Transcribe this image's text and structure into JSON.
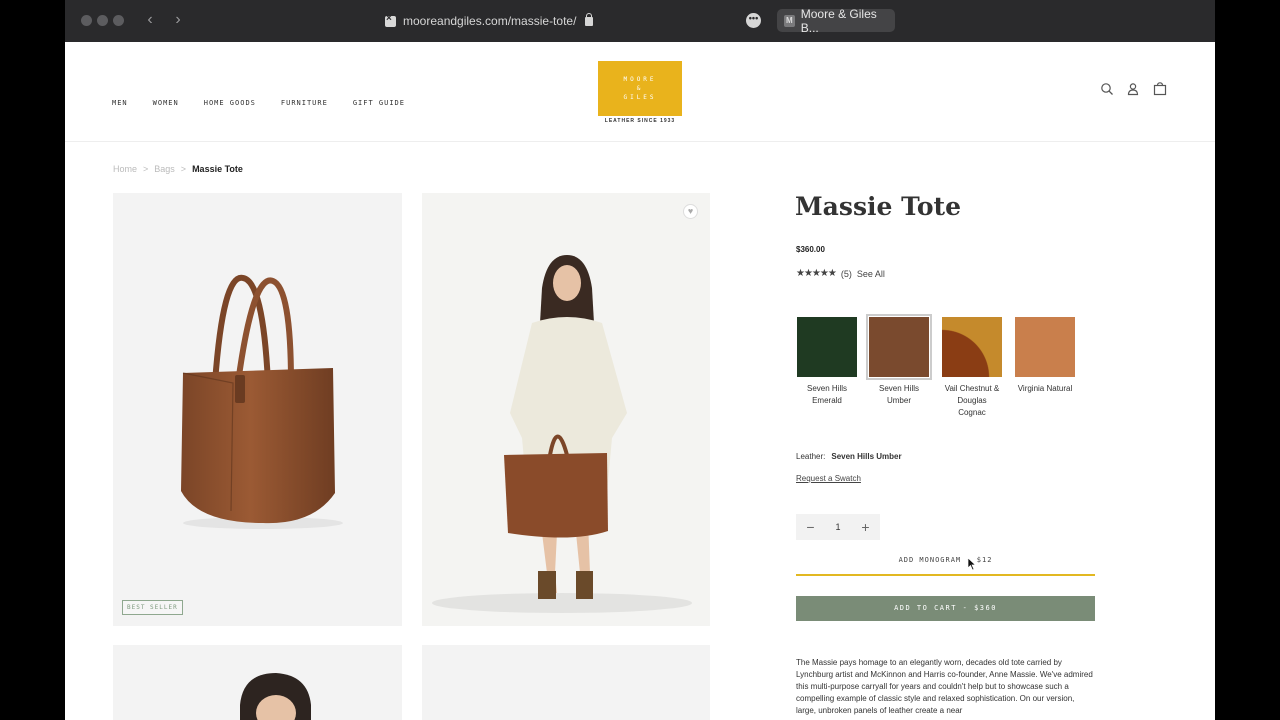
{
  "browser": {
    "url": "mooreandgiles.com/massie-tote/",
    "tab_title": "Moore & Giles B...",
    "tab_favicon_letter": "M",
    "icons": [
      "back-icon",
      "forward-icon",
      "lock-icon",
      "more-icon"
    ]
  },
  "header": {
    "nav": [
      "MEN",
      "WOMEN",
      "HOME GOODS",
      "FURNITURE",
      "GIFT GUIDE"
    ],
    "logo_lines": [
      "MOORE",
      "&",
      "GILES"
    ],
    "logo_tagline": "LEATHER SINCE 1933",
    "logo_color": "#e9b31c",
    "icons": [
      "search-icon",
      "account-icon",
      "cart-icon"
    ]
  },
  "breadcrumb": {
    "items": [
      "Home",
      "Bags",
      "Massie Tote"
    ],
    "separator": ">"
  },
  "gallery": {
    "badge": "BEST SELLER",
    "icons": [
      "wishlist-heart-icon"
    ]
  },
  "product": {
    "title": "Massie Tote",
    "price": "$360.00",
    "stars": "★★★★★",
    "rating_count": "(5)",
    "see_all": "See All",
    "swatches": [
      {
        "line1": "Seven Hills",
        "line2": "Emerald",
        "line3": "",
        "color": "#1f3a22"
      },
      {
        "line1": "Seven Hills",
        "line2": "Umber",
        "line3": "",
        "color": "#7a4a2e"
      },
      {
        "line1": "Vail Chestnut &",
        "line2": "Douglas",
        "line3": "Cognac",
        "color": "#c58a2c"
      },
      {
        "line1": "Virginia Natural",
        "line2": "",
        "line3": "",
        "color": "#c97f4c"
      }
    ],
    "leather_label": "Leather:",
    "leather_value": "Seven Hills Umber",
    "request_swatch": "Request a Swatch",
    "quantity": "1",
    "qty_minus": "−",
    "qty_plus": "+",
    "monogram": "ADD MONOGRAM - $12",
    "add_to_cart": "ADD TO CART - $360",
    "cart_button_color": "#7a8c77",
    "description": "The Massie pays homage to an elegantly worn, decades old tote carried by Lynchburg artist and McKinnon and Harris co-founder, Anne Massie. We've admired this multi-purpose carryall for years and couldn't help but to showcase such a compelling example of classic style and relaxed sophistication. On our version, large, unbroken panels of leather create a near"
  }
}
